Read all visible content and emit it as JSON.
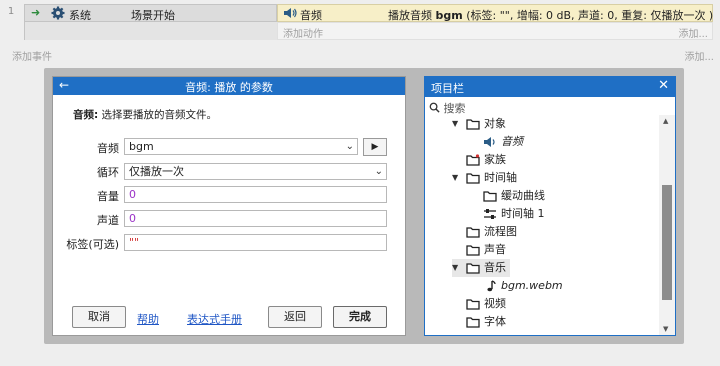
{
  "event_sheet": {
    "row_number": "1",
    "condition_object": "系统",
    "condition_text": "场景开始",
    "action_object": "音频",
    "action_text_prefix": "播放音频 ",
    "action_text_bold": "bgm",
    "action_text_suffix": " (标签: \"\", 增幅: 0 dB, 声道: 0, 重复: 仅播放一次 )",
    "add_action": "添加动作",
    "add_action_right": "添加...",
    "add_event": "添加事件",
    "add_event_right": "添加..."
  },
  "dialog": {
    "title": "音频: 播放 的参数",
    "desc_bold": "音频:",
    "desc_text": " 选择要播放的音频文件。",
    "fields": [
      {
        "label": "音频",
        "value": "bgm"
      },
      {
        "label": "循环",
        "value": "仅播放一次"
      },
      {
        "label": "音量",
        "value": "0"
      },
      {
        "label": "声道",
        "value": "0"
      },
      {
        "label": "标签(可选)",
        "value": "\"\""
      }
    ],
    "buttons": {
      "cancel": "取消",
      "help": "帮助",
      "expression_manual": "表达式手册",
      "back": "返回",
      "done": "完成"
    }
  },
  "project_panel": {
    "title": "项目栏",
    "search_placeholder": "搜索",
    "items": [
      {
        "label": "对象"
      },
      {
        "label": "音频"
      },
      {
        "label": "家族"
      },
      {
        "label": "时间轴"
      },
      {
        "label": "缓动曲线"
      },
      {
        "label": "时间轴 1"
      },
      {
        "label": "流程图"
      },
      {
        "label": "声音"
      },
      {
        "label": "音乐"
      },
      {
        "label": "bgm.webm"
      },
      {
        "label": "视频"
      },
      {
        "label": "字体"
      }
    ]
  },
  "colors": {
    "accent": "#1f6fc5",
    "action_bg": "#f7efc8",
    "number_value": "#9b33c7",
    "string_value": "#d23131"
  }
}
